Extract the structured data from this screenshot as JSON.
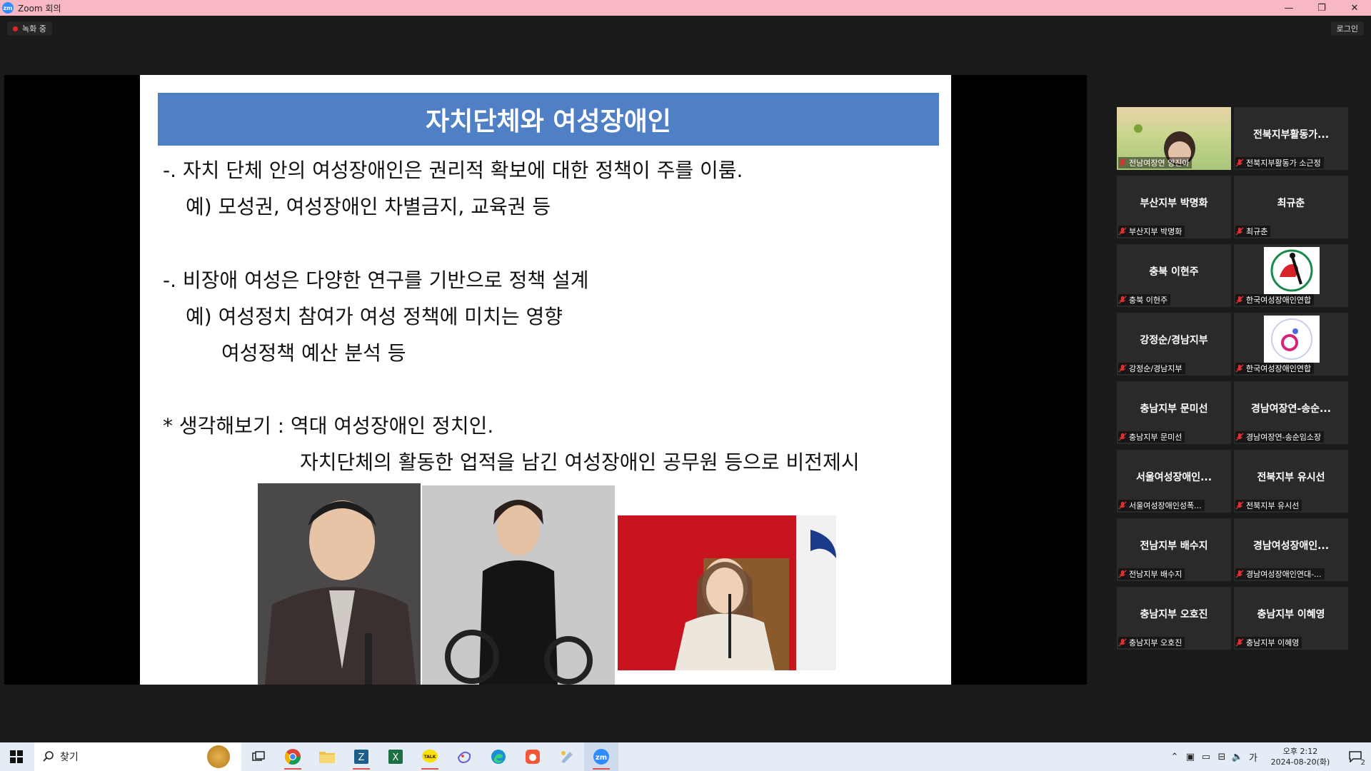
{
  "window": {
    "title": "Zoom 회의",
    "logo": "zm",
    "minimize": "—",
    "maximize": "❐",
    "close": "✕"
  },
  "topbar": {
    "recording_label": "녹화 중",
    "login_label": "로그인"
  },
  "slide": {
    "title": "자치단체와 여성장애인",
    "lines": [
      "-. 자치 단체 안의 여성장애인은 권리적 확보에 대한 정책이 주를 이룸.",
      "예) 모성권, 여성장애인 차별금지, 교육권 등",
      "-. 비장애 여성은 다양한 연구를 기반으로 정책 설계",
      "예) 여성정치 참여가 여성 정책에 미치는 영향",
      "여성정책 예산 분석 등",
      "* 생각해보기 : 역대 여성장애인 정치인.",
      "자치단체의 활동한 업적을 남긴 여성장애인 공무원 등으로 비전제시"
    ]
  },
  "participants": [
    {
      "name": "",
      "label": "전남여장연 양진아",
      "type": "video"
    },
    {
      "name": "전북지부활동가...",
      "label": "전북지부활동가 소근정",
      "type": "name"
    },
    {
      "name": "부산지부 박명화",
      "label": "부산지부 박명화",
      "type": "name"
    },
    {
      "name": "최규춘",
      "label": "최규춘",
      "type": "name"
    },
    {
      "name": "충북 이현주",
      "label": "충북 이현주",
      "type": "name"
    },
    {
      "name": "",
      "label": "한국여성장애인연합",
      "type": "logo"
    },
    {
      "name": "강정순/경남지부",
      "label": "강정순/경남지부",
      "type": "name"
    },
    {
      "name": "",
      "label": "한국여성장애인연합",
      "type": "logo2"
    },
    {
      "name": "충남지부 문미선",
      "label": "충남지부 문미선",
      "type": "name"
    },
    {
      "name": "경남여장연-송순...",
      "label": "경남여장연-송순임소장",
      "type": "name"
    },
    {
      "name": "서울여성장애인...",
      "label": "서울여성장애인성폭...",
      "type": "name"
    },
    {
      "name": "전북지부 유시선",
      "label": "전북지부 유시선",
      "type": "name"
    },
    {
      "name": "전남지부 배수지",
      "label": "전남지부 배수지",
      "type": "name"
    },
    {
      "name": "경남여성장애인...",
      "label": "경남여성장애인연대-...",
      "type": "name"
    },
    {
      "name": "충남지부 오호진",
      "label": "충남지부 오호진",
      "type": "name"
    },
    {
      "name": "충남지부 이혜영",
      "label": "충남지부 이혜영",
      "type": "name"
    }
  ],
  "taskbar": {
    "search_label": "찾기",
    "apps": [
      "task-view",
      "chrome",
      "file-explorer",
      "z-app",
      "excel",
      "kakaotalk",
      "paint-3d",
      "edge",
      "zoom-ish",
      "paint",
      "zoom"
    ],
    "clock_time": "오후 2:12",
    "clock_date": "2024-08-20(화)",
    "ime": "가",
    "notification_count": "2"
  },
  "colors": {
    "titlebar": "#f7b8c3",
    "slide_header": "#4f7fc5",
    "muted_mic": "#e03030",
    "zoom_blue": "#2d8cff"
  }
}
